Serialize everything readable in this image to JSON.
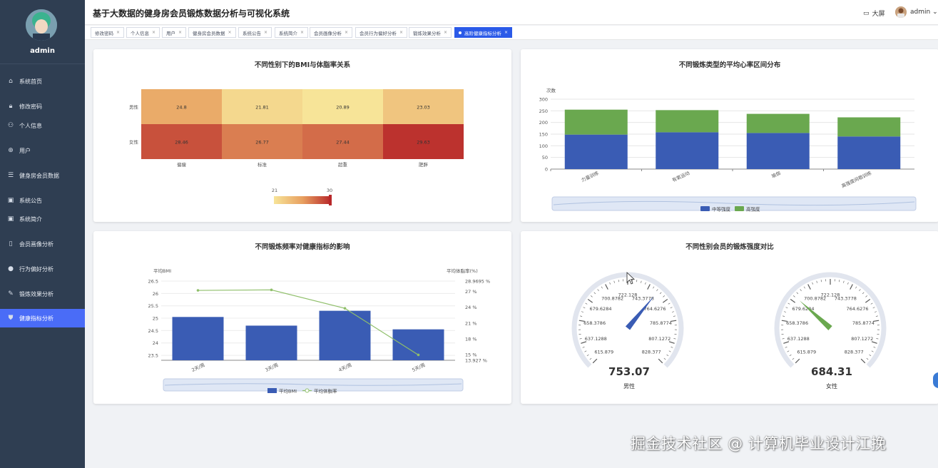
{
  "app_title": "基于大数据的健身房会员锻炼数据分析与可视化系统",
  "sidebar": {
    "username": "admin",
    "items": [
      {
        "label": "系统首页",
        "icon": "⌂",
        "icon_name": "home-icon",
        "active": false
      },
      {
        "label": "修改密码",
        "icon": "🔒︎",
        "icon_name": "lock-icon",
        "active": false
      },
      {
        "label": "个人信息",
        "icon": "⚇",
        "icon_name": "user-icon",
        "active": false
      },
      {
        "label": "用户",
        "icon": "⊕",
        "icon_name": "globe-icon",
        "active": false
      },
      {
        "label": "健身房会员数据",
        "icon": "☰",
        "icon_name": "list-icon",
        "active": false
      },
      {
        "label": "系统公告",
        "icon": "▣",
        "icon_name": "notice-icon",
        "active": false
      },
      {
        "label": "系统简介",
        "icon": "▣",
        "icon_name": "intro-icon",
        "active": false
      },
      {
        "label": "会员画像分析",
        "icon": "▯",
        "icon_name": "phone-icon",
        "active": false
      },
      {
        "label": "行为偏好分析",
        "icon": "●",
        "icon_name": "bulb-icon",
        "active": false
      },
      {
        "label": "锻炼效果分析",
        "icon": "✎",
        "icon_name": "edit-icon",
        "active": false
      },
      {
        "label": "健康指标分析",
        "icon": "⛊",
        "icon_name": "shield-icon",
        "active": true
      }
    ]
  },
  "header": {
    "bigscreen_label": "大屏",
    "username": "admin"
  },
  "tabs": [
    {
      "label": "修改密码",
      "active": false
    },
    {
      "label": "个人信息",
      "active": false
    },
    {
      "label": "用户",
      "active": false
    },
    {
      "label": "健身房会员数据",
      "active": false
    },
    {
      "label": "系统公告",
      "active": false
    },
    {
      "label": "系统简介",
      "active": false
    },
    {
      "label": "会员画像分析",
      "active": false
    },
    {
      "label": "会员行为偏好分析",
      "active": false
    },
    {
      "label": "锻炼效果分析",
      "active": false
    },
    {
      "label": "高阶健康指标分析",
      "active": true
    }
  ],
  "tab_close": "×",
  "watermark": "掘金技术社区 @ 计算机毕业设计江挽",
  "chart_data": [
    {
      "type": "heatmap",
      "title": "不同性别下的BMI与体脂率关系",
      "x_categories": [
        "偏瘦",
        "标准",
        "超重",
        "肥胖"
      ],
      "y_categories": [
        "男性",
        "女性"
      ],
      "values": [
        [
          24.8,
          21.81,
          20.89,
          23.03
        ],
        [
          28.46,
          26.77,
          27.44,
          29.63
        ]
      ],
      "visual_map": {
        "min": 21,
        "max": 30,
        "min_label": "21",
        "max_label": "30",
        "colors": [
          "#f7e498",
          "#e8a060",
          "#b8282a"
        ]
      }
    },
    {
      "type": "bar",
      "stacked": true,
      "title": "不同锻炼类型的平均心率区间分布",
      "ylabel": "次数",
      "ylim": [
        0,
        300
      ],
      "yticks": [
        "0",
        "50",
        "100",
        "150",
        "200",
        "250",
        "300"
      ],
      "categories": [
        "力量训练",
        "有氧运动",
        "瑜伽",
        "高强度间歇训练"
      ],
      "series": [
        {
          "name": "中等强度",
          "color": "#3a5cb4",
          "values": [
            148,
            158,
            155,
            140
          ]
        },
        {
          "name": "高强度",
          "color": "#6aa84f",
          "values": [
            107,
            95,
            82,
            82
          ]
        }
      ],
      "legend": "bottom"
    },
    {
      "type": "bar",
      "title": "不同锻炼频率对健康指标的影响",
      "categories": [
        "2天/周",
        "3天/周",
        "4天/周",
        "5天/周"
      ],
      "y_left": {
        "label": "平均BMI",
        "min": 23.3,
        "max": 26.5,
        "ticks": [
          "26.5",
          "26",
          "25.5",
          "25",
          "24.5",
          "24",
          "23.5"
        ]
      },
      "y_right": {
        "label": "平均体脂率(%)",
        "min": 13.927,
        "max": 28.9695,
        "ticks": [
          "28.9695 %",
          "27 %",
          "24 %",
          "21 %",
          "18 %",
          "15 %",
          "13.927 %"
        ]
      },
      "series": [
        {
          "name": "平均BMI",
          "type": "bar",
          "axis": "left",
          "color": "#3a5cb4",
          "values": [
            25.05,
            24.7,
            25.3,
            24.55
          ]
        },
        {
          "name": "平均体脂率",
          "type": "line",
          "axis": "right",
          "color": "#8fbf6a",
          "values": [
            27.2,
            27.3,
            23.8,
            14.95
          ]
        }
      ],
      "legend": "bottom"
    },
    {
      "type": "gauge",
      "title": "不同性别会员的锻炼强度对比",
      "min": 615.879,
      "max": 828.377,
      "tick_labels": [
        "615.879",
        "637.1288",
        "658.3786",
        "679.6284",
        "700.8782",
        "722.128",
        "743.3778",
        "764.6276",
        "785.8774",
        "807.1272",
        "828.377"
      ],
      "gauges": [
        {
          "name": "男性",
          "value": 753.07,
          "value_label": "753.07",
          "color": "#3a5cb4"
        },
        {
          "name": "女性",
          "value": 684.31,
          "value_label": "684.31",
          "color": "#6aa84f"
        }
      ]
    }
  ]
}
